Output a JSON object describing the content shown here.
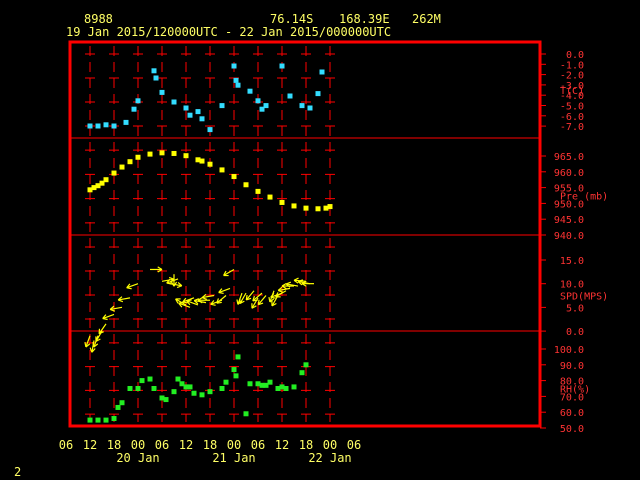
{
  "header": {
    "station_id": "8988",
    "lat": "76.14S",
    "lon": "168.39E",
    "elev": "262M",
    "date_range": "19 Jan 2015/120000UTC - 22 Jan 2015/000000UTC"
  },
  "footer": {
    "page_num": "2"
  },
  "colors": {
    "frame": "#ff0000",
    "text": "#ffff66",
    "axis_text": "#ff3333",
    "temp": "#33ddff",
    "pressure": "#ffff00",
    "wind": "#ffff00",
    "rh": "#22ee22"
  },
  "chart_data": [
    {
      "type": "scatter",
      "ylabel": "T(C)",
      "y_ticks": [
        "0.0",
        "-1.0",
        "-2.0",
        "-3.0",
        "-4.0",
        "-5.0",
        "-6.0",
        "-7.0"
      ],
      "ylim": [
        -7,
        0
      ],
      "x_hours": [
        12,
        14,
        16,
        18,
        21,
        23,
        24,
        28,
        28.5,
        30,
        33,
        36,
        37,
        39,
        40,
        42,
        45,
        48,
        48.5,
        49,
        52,
        54,
        55,
        56,
        60,
        62,
        65,
        67,
        69,
        70
      ],
      "values": [
        -6.0,
        -6.0,
        -5.9,
        -6.0,
        -5.7,
        -4.6,
        -3.9,
        -1.4,
        -2.0,
        -3.2,
        -4.0,
        -4.5,
        -5.1,
        -4.8,
        -5.4,
        -6.3,
        -4.3,
        -1.0,
        -2.2,
        -2.6,
        -3.1,
        -3.9,
        -4.6,
        -4.3,
        -1.0,
        -3.5,
        -4.3,
        -4.5,
        -3.3,
        -1.5
      ]
    },
    {
      "type": "scatter",
      "ylabel": "Pre (mb)",
      "y_ticks": [
        "965.0",
        "960.0",
        "955.0",
        "950.0",
        "945.0",
        "940.0"
      ],
      "ylim": [
        940,
        967
      ],
      "x_hours": [
        12,
        13,
        14,
        15,
        16,
        18,
        20,
        22,
        24,
        27,
        30,
        33,
        36,
        39,
        40,
        42,
        45,
        48,
        51,
        54,
        57,
        60,
        63,
        66,
        69,
        71,
        72
      ],
      "values": [
        954.3,
        955.0,
        955.6,
        956.4,
        957.5,
        959.6,
        961.5,
        963.2,
        964.6,
        965.6,
        966.0,
        965.8,
        965.1,
        963.8,
        963.4,
        962.4,
        960.6,
        958.5,
        955.9,
        953.8,
        952.0,
        950.3,
        949.2,
        948.5,
        948.3,
        948.5,
        949.0
      ]
    },
    {
      "type": "scatter",
      "ylabel": "SPD(MPS)",
      "y_ticks": [
        "15.0",
        "10.0",
        "5.0",
        "0.0"
      ],
      "ylim": [
        0,
        20
      ],
      "x_hours": [
        12,
        13,
        14,
        15,
        16,
        18,
        20,
        22,
        24,
        27,
        30,
        32,
        33,
        34,
        36,
        37,
        38,
        39,
        41,
        42,
        43,
        45,
        46,
        47,
        48,
        50,
        51,
        53,
        54,
        55,
        56,
        58,
        59,
        60,
        61,
        62,
        63,
        64,
        66,
        67,
        68
      ],
      "values": [
        16.0,
        17.0,
        16.0,
        15.0,
        13.5,
        11.5,
        10.0,
        8.0,
        5.0,
        2.0,
        4.5,
        5.0,
        3.0,
        4.0,
        9.5,
        10.0,
        8.0,
        9.5,
        9.0,
        8.5,
        7.5,
        8.5,
        7.5,
        6.0,
        2.0,
        7.0,
        7.0,
        6.5,
        8.0,
        7.0,
        7.5,
        6.5,
        7.5,
        7.0,
        6.5,
        6.0,
        5.5,
        5.5,
        4.5,
        5.0,
        5.0
      ],
      "directions_deg": [
        200,
        190,
        200,
        210,
        215,
        250,
        260,
        260,
        250,
        90,
        80,
        100,
        180,
        250,
        300,
        290,
        250,
        290,
        280,
        270,
        260,
        250,
        230,
        250,
        240,
        200,
        210,
        220,
        210,
        230,
        220,
        200,
        210,
        250,
        240,
        260,
        270,
        280,
        275,
        280,
        270
      ]
    },
    {
      "type": "scatter",
      "ylabel": "RH(%)",
      "y_ticks": [
        "100.0",
        "90.0",
        "80.0",
        "70.0",
        "60.0",
        "50.0"
      ],
      "ylim": [
        50,
        102
      ],
      "x_hours": [
        12,
        14,
        16,
        18,
        19,
        20,
        22,
        24,
        25,
        27,
        28,
        30,
        31,
        33,
        34,
        35,
        36,
        37,
        38,
        40,
        42,
        45,
        46,
        48,
        48.5,
        49,
        51,
        52,
        54,
        55,
        56,
        57,
        59,
        60,
        61,
        63,
        65,
        66
      ],
      "values": [
        95,
        95,
        95,
        94,
        87,
        84,
        75,
        75,
        70,
        69,
        75,
        81,
        82,
        77,
        69,
        72,
        74,
        74,
        78,
        79,
        77,
        75,
        71,
        63,
        67,
        55,
        91,
        72,
        72,
        73,
        73,
        71,
        75,
        74,
        75,
        74,
        65,
        60
      ]
    }
  ],
  "x_axis": {
    "tick_labels": [
      "06",
      "12",
      "18",
      "00",
      "06",
      "12",
      "18",
      "00",
      "06",
      "12",
      "18",
      "00",
      "06"
    ],
    "day_labels": [
      {
        "text": "20 Jan",
        "hour": 24
      },
      {
        "text": "21 Jan",
        "hour": 48
      },
      {
        "text": "22 Jan",
        "hour": 72
      }
    ]
  }
}
